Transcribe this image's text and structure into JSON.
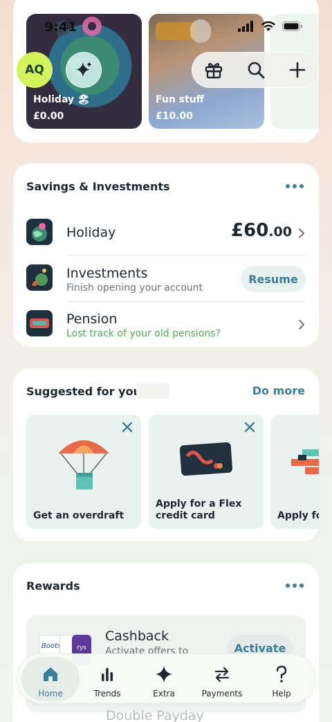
{
  "status_bar": {
    "time": "9:41"
  },
  "header": {
    "avatar_initials": "AQ"
  },
  "pots": [
    {
      "name": "Holiday 🏖",
      "amount": "£0.00"
    },
    {
      "name": "Fun stuff",
      "amount": "£10.00"
    }
  ],
  "savings": {
    "title": "Savings & Investments",
    "rows": [
      {
        "title": "Holiday",
        "amount_main": "£60",
        "amount_pence": ".00"
      },
      {
        "title": "Investments",
        "subtitle": "Finish opening your account",
        "action": "Resume"
      },
      {
        "title": "Pension",
        "subtitle": "Lost track of your old pensions?"
      }
    ]
  },
  "suggested": {
    "title": "Suggested for you,",
    "action": "Do more",
    "tiles": [
      {
        "label": "Get an overdraft"
      },
      {
        "label_line1": "Apply for a Flex",
        "label_line2": "credit card"
      },
      {
        "label": "Apply fo"
      }
    ]
  },
  "rewards": {
    "title": "Rewards",
    "offer_title": "Cashback",
    "offer_subtitle": "Activate offers to",
    "offer_action": "Activate",
    "next_item": "Double Payday"
  },
  "nav": [
    {
      "label": "Home",
      "active": true
    },
    {
      "label": "Trends"
    },
    {
      "label": "Extra"
    },
    {
      "label": "Payments"
    },
    {
      "label": "Help"
    }
  ],
  "colors": {
    "accent": "#3b7d9c",
    "avatar_bg": "#d4f35a",
    "positive": "#4caf50"
  }
}
